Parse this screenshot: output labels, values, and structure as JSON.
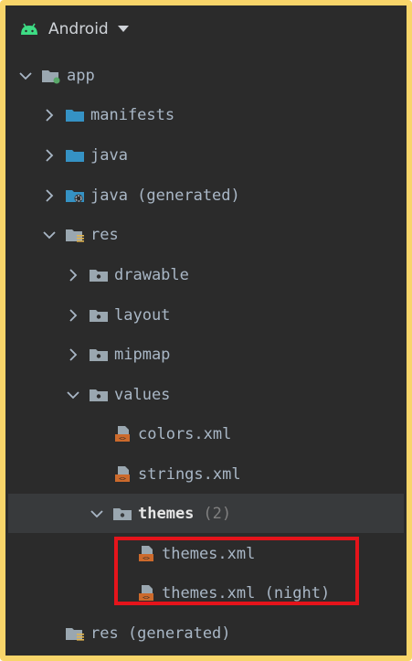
{
  "header": {
    "title": "Android"
  },
  "tree": [
    {
      "label": "app",
      "count": "",
      "icon": "module-folder-icon",
      "chevron": "down"
    },
    {
      "label": "manifests",
      "count": "",
      "icon": "folder-icon",
      "chevron": "right"
    },
    {
      "label": "java",
      "count": "",
      "icon": "folder-icon",
      "chevron": "right"
    },
    {
      "label": "java (generated)",
      "count": "",
      "icon": "generated-folder-icon",
      "chevron": "right"
    },
    {
      "label": "res",
      "count": "",
      "icon": "resource-folder-icon",
      "chevron": "down"
    },
    {
      "label": "drawable",
      "count": "",
      "icon": "package-folder-icon",
      "chevron": "right"
    },
    {
      "label": "layout",
      "count": "",
      "icon": "package-folder-icon",
      "chevron": "right"
    },
    {
      "label": "mipmap",
      "count": "",
      "icon": "package-folder-icon",
      "chevron": "right"
    },
    {
      "label": "values",
      "count": "",
      "icon": "package-folder-icon",
      "chevron": "down"
    },
    {
      "label": "colors.xml",
      "count": "",
      "icon": "xml-file-icon",
      "chevron": ""
    },
    {
      "label": "strings.xml",
      "count": "",
      "icon": "xml-file-icon",
      "chevron": ""
    },
    {
      "label": "themes",
      "count": "(2)",
      "icon": "package-folder-icon",
      "chevron": "down"
    },
    {
      "label": "themes.xml",
      "count": "",
      "icon": "xml-file-icon",
      "chevron": ""
    },
    {
      "label": "themes.xml (night)",
      "count": "",
      "icon": "xml-file-icon",
      "chevron": ""
    },
    {
      "label": "res (generated)",
      "count": "",
      "icon": "resource-folder-icon",
      "chevron": ""
    }
  ],
  "colors": {
    "background": "#2b2b2b",
    "frame": "#f8d56a",
    "highlight_box": "#e5141b",
    "selected_row": "#383a3c"
  }
}
